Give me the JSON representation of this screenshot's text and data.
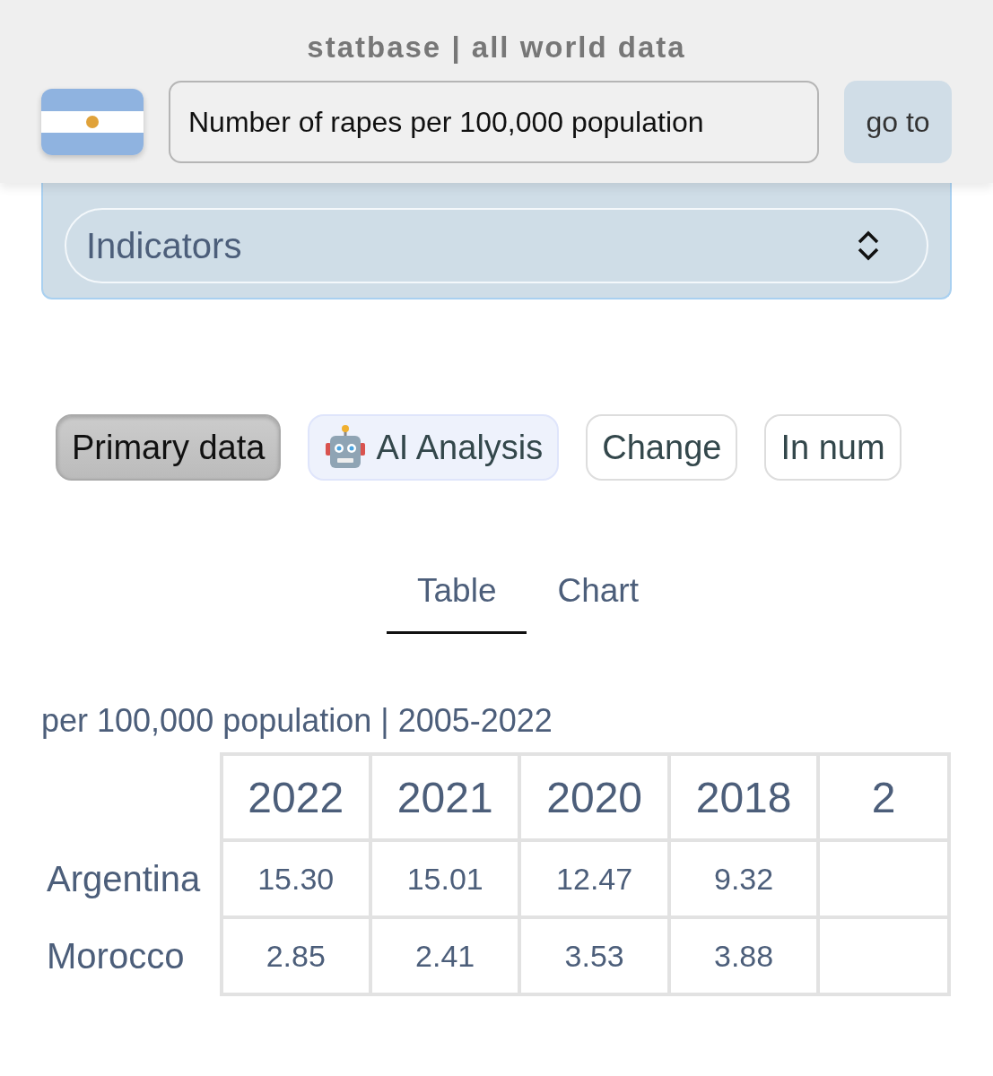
{
  "header": {
    "title": "statbase | all world data",
    "search": {
      "value": "Number of rapes per 100,000 population"
    },
    "go_button": "go to"
  },
  "indicator_select": {
    "value": "Indicators"
  },
  "view_buttons": [
    {
      "label": "Primary data",
      "selected": true,
      "kind": "plain"
    },
    {
      "label": "AI Analysis",
      "selected": false,
      "kind": "robot"
    },
    {
      "label": "Change",
      "selected": false,
      "kind": "plain"
    },
    {
      "label": "In num",
      "selected": false,
      "kind": "plain"
    }
  ],
  "tabs": [
    {
      "label": "Table",
      "selected": true
    },
    {
      "label": "Chart",
      "selected": false
    }
  ],
  "table": {
    "caption": "per 100,000 population | 2005-2022",
    "columns": [
      "2022",
      "2021",
      "2020",
      "2018",
      "2"
    ],
    "rows": [
      {
        "label": "Argentina",
        "cells": [
          "15.30",
          "15.01",
          "12.47",
          "9.32"
        ]
      },
      {
        "label": "Morocco",
        "cells": [
          "2.85",
          "2.41",
          "3.53",
          "3.88"
        ]
      }
    ]
  }
}
